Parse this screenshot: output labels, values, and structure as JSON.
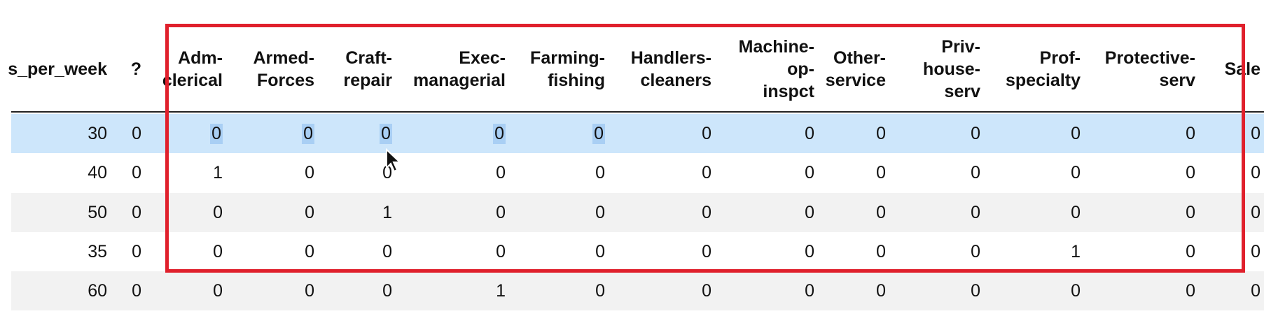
{
  "columns": [
    "s_per_week",
    "?",
    "Adm-\nclerical",
    "Armed-\nForces",
    "Craft-\nrepair",
    "Exec-\nmanagerial",
    "Farming-\nfishing",
    "Handlers-\ncleaners",
    "Machine-\nop-\ninspct",
    "Other-\nservice",
    "Priv-\nhouse-\nserv",
    "Prof-\nspecialty",
    "Protective-\nserv",
    "Sale"
  ],
  "rows": [
    {
      "cells": [
        "30",
        "0",
        "0",
        "0",
        "0",
        "0",
        "0",
        "0",
        "0",
        "0",
        "0",
        "0",
        "0",
        "0"
      ],
      "selected": true
    },
    {
      "cells": [
        "40",
        "0",
        "1",
        "0",
        "0",
        "0",
        "0",
        "0",
        "0",
        "0",
        "0",
        "0",
        "0",
        "0"
      ],
      "selected": false
    },
    {
      "cells": [
        "50",
        "0",
        "0",
        "0",
        "1",
        "0",
        "0",
        "0",
        "0",
        "0",
        "0",
        "0",
        "0",
        "0"
      ],
      "selected": false
    },
    {
      "cells": [
        "35",
        "0",
        "0",
        "0",
        "0",
        "0",
        "0",
        "0",
        "0",
        "0",
        "0",
        "1",
        "0",
        "0"
      ],
      "selected": false
    },
    {
      "cells": [
        "60",
        "0",
        "0",
        "0",
        "0",
        "1",
        "0",
        "0",
        "0",
        "0",
        "0",
        "0",
        "0",
        "0"
      ],
      "selected": false
    }
  ],
  "highlight_color": "#e0202c",
  "selection_color": "#cde6fb"
}
